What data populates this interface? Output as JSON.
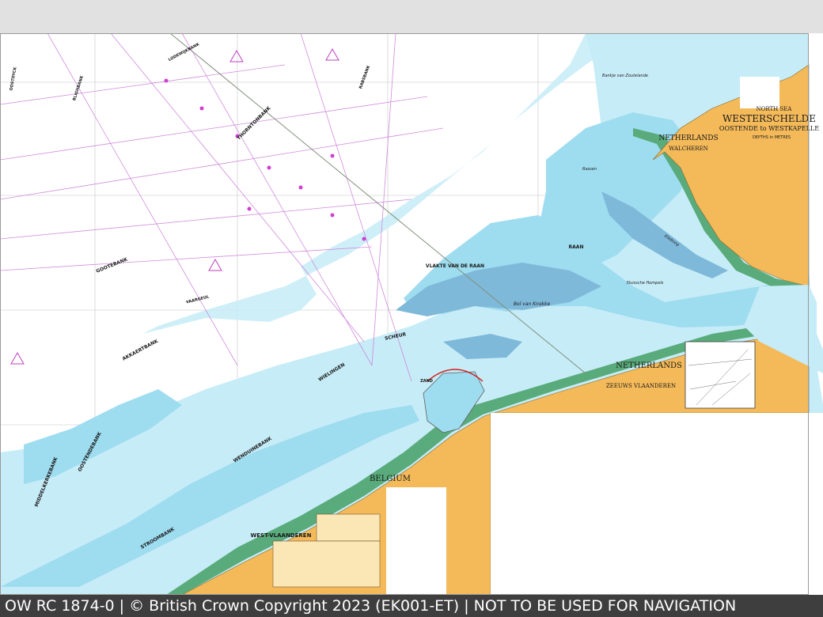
{
  "footer": {
    "caption": "OW RC 1874-0 | © British Crown Copyright 2023 (EK001-ET) | NOT TO BE USED FOR NAVIGATION"
  },
  "title_block": {
    "sea": "NORTH SEA",
    "title": "WESTERSCHELDE",
    "subtitle": "OOSTENDE to WESTKAPELLE",
    "depths": "DEPTHS in METRES"
  },
  "labels": {
    "netherlands_north": "NETHERLANDS",
    "walcheren": "WALCHEREN",
    "netherlands_south": "NETHERLANDS",
    "zeeuws_vlaanderen": "ZEEUWS VLAANDEREN",
    "belgium": "BELGIUM",
    "west_vlaanderen": "WEST-VLAANDEREN",
    "vlakte_van_de_raan": "VLAKTE VAN DE RAAN",
    "raan": "RAAN",
    "bol_van_knokke": "Bol van Knokke",
    "wielingen": "WIELINGEN",
    "scheur": "SCHEUR",
    "zand": "ZAND",
    "gootebank": "GOOTEBANK",
    "thorntonbank": "THORNTONBANK",
    "akkaertbank": "AKKAERTBANK",
    "wenduinebank": "WENDUINEBANK",
    "stroombank": "STROOMBANK",
    "oostendebank": "OOSTENDEBANK",
    "middelkerkebank": "MIDDELKERKEBANK",
    "bligh_bank": "BLIGHBANK",
    "raebsbank": "RABSBANK",
    "lodewijkbank": "LODEWIJKBANK",
    "oostdyck": "OOSTDYCK",
    "vaarngeul": "VAARGEUL",
    "rassen": "Rassen",
    "bankje": "Bankje van Zoutelande",
    "elleboog": "Elleboog",
    "sluissche_hompels": "Sluissche Hompels"
  },
  "colors": {
    "background": "#ffffff",
    "deep_water": "#ffffff",
    "shallow_water": "#c6ecf7",
    "shoal_water": "#9edcf0",
    "drying_bank": "#7fb9d9",
    "intertidal": "#59ab7b",
    "land": "#f4ba5a",
    "route_lines": "#cc7fd9",
    "grid": "#b5b5b5",
    "footer_bg": "#3e3e3e",
    "top_band": "#e1e1e1"
  }
}
